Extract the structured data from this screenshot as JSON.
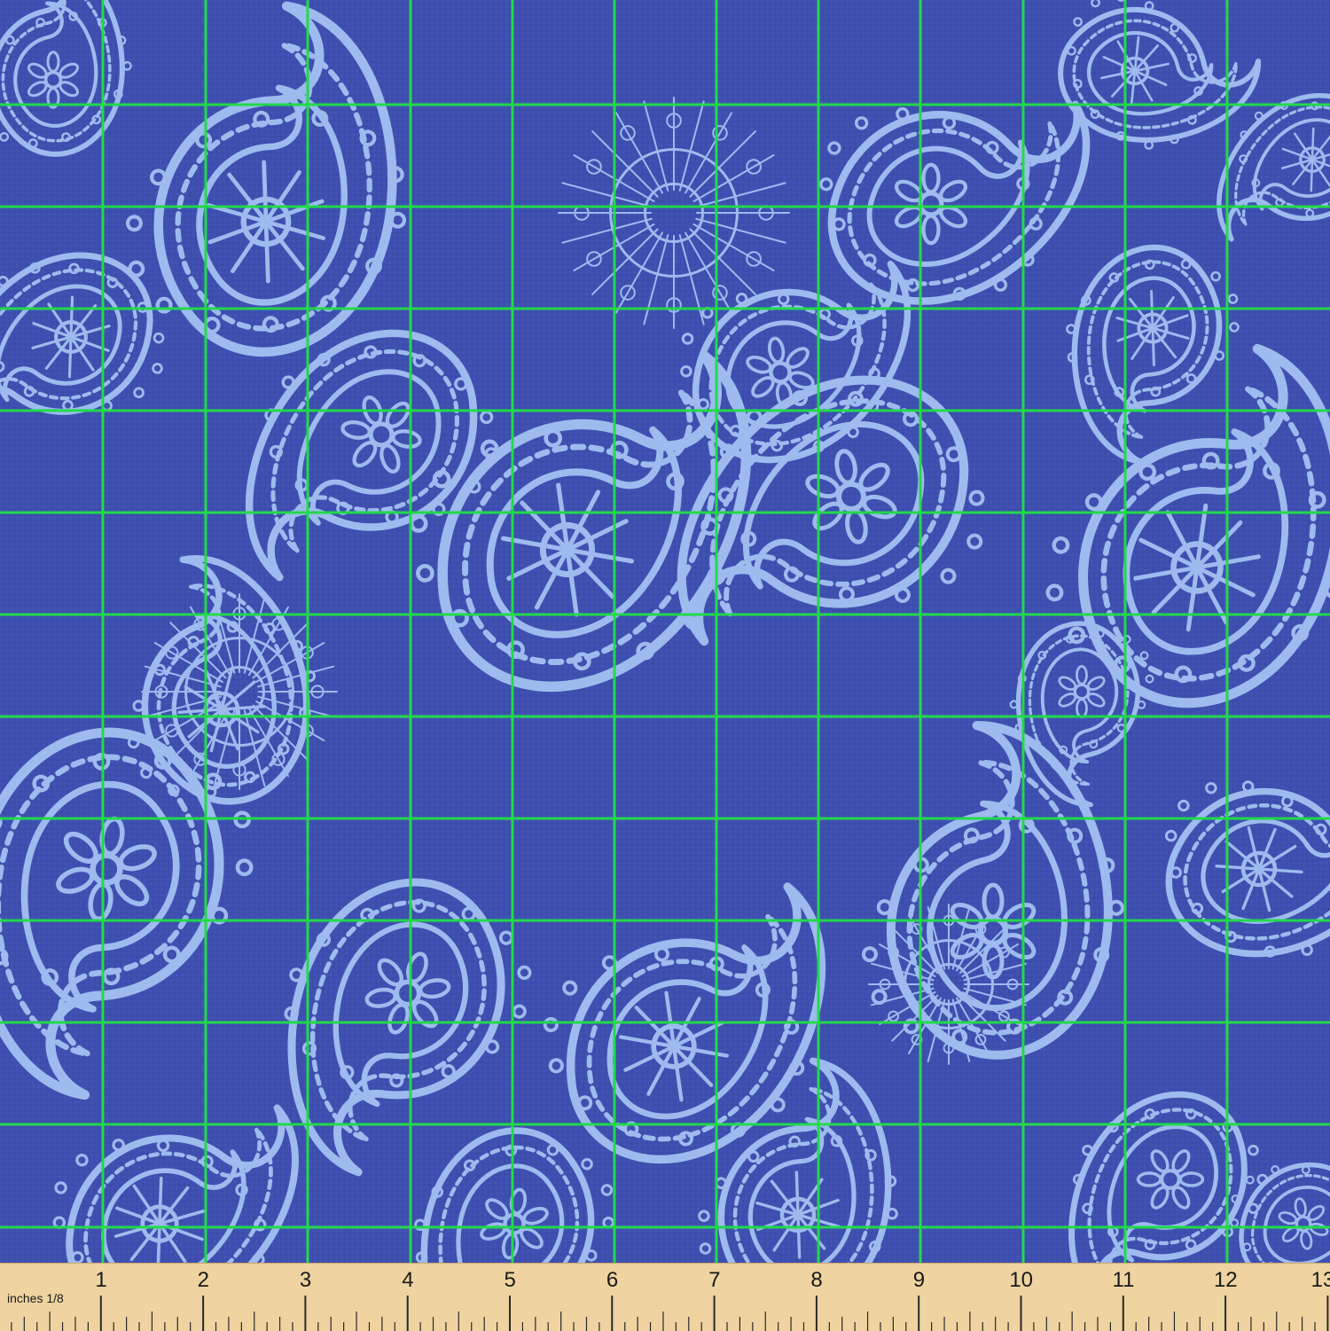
{
  "fabric": {
    "background_color": "#3f4fb0",
    "motif_color": "#9dbbee",
    "grid_line_color": "#22d94a",
    "motif": "paisley"
  },
  "ruler": {
    "unit_label": "inches 1/8",
    "numbers": [
      "1",
      "2",
      "3",
      "4",
      "5",
      "6",
      "7",
      "8",
      "9",
      "10",
      "11",
      "12",
      "13"
    ],
    "background_color": "#efd3a0"
  }
}
